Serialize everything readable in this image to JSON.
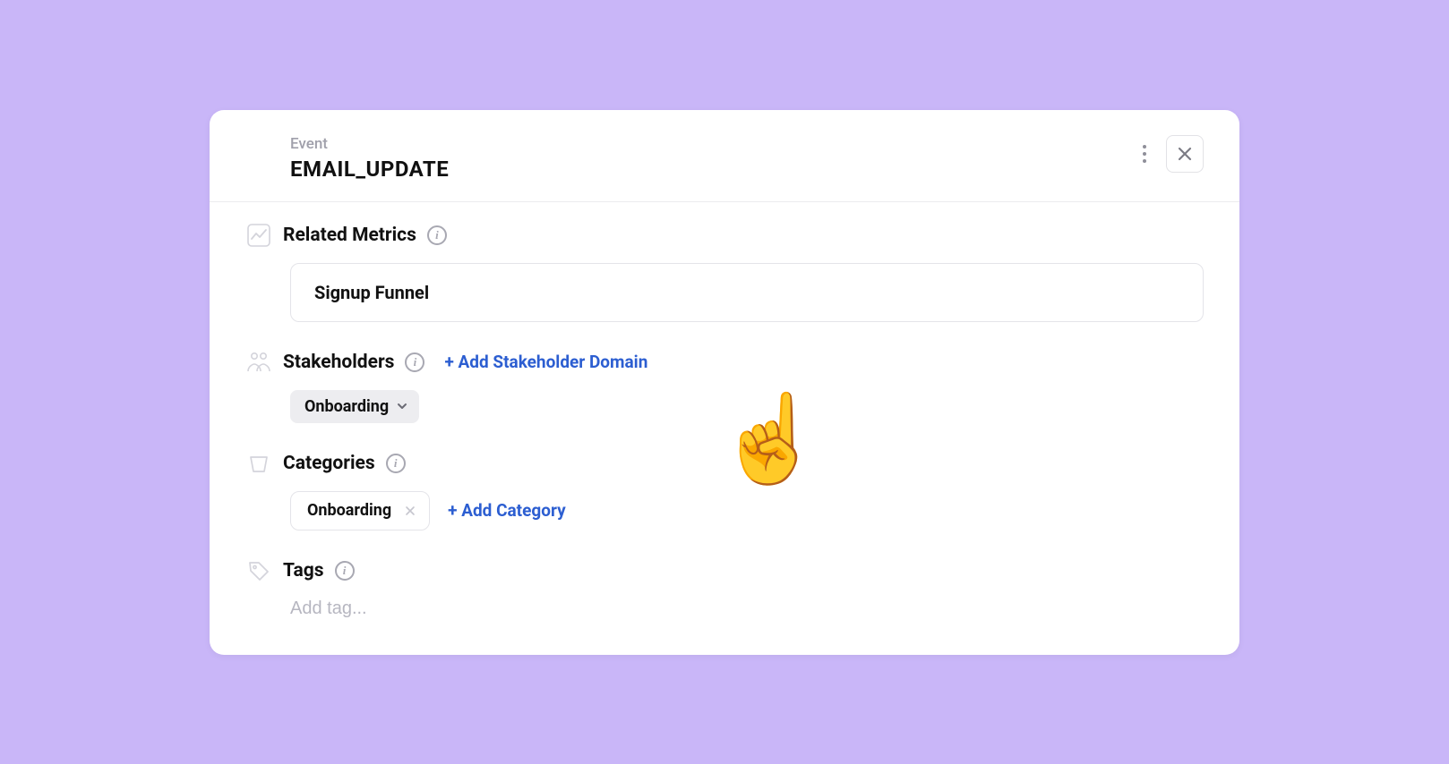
{
  "header": {
    "eyebrow": "Event",
    "title": "EMAIL_UPDATE"
  },
  "sections": {
    "metrics": {
      "title": "Related Metrics",
      "item": "Signup Funnel"
    },
    "stakeholders": {
      "title": "Stakeholders",
      "add_label": "+ Add Stakeholder Domain",
      "chip": "Onboarding"
    },
    "categories": {
      "title": "Categories",
      "add_label": "+ Add Category",
      "chip": "Onboarding"
    },
    "tags": {
      "title": "Tags",
      "placeholder": "Add tag..."
    }
  },
  "info_glyph": "i",
  "colors": {
    "link": "#2c5ed1",
    "background": "#c9b6f8"
  }
}
